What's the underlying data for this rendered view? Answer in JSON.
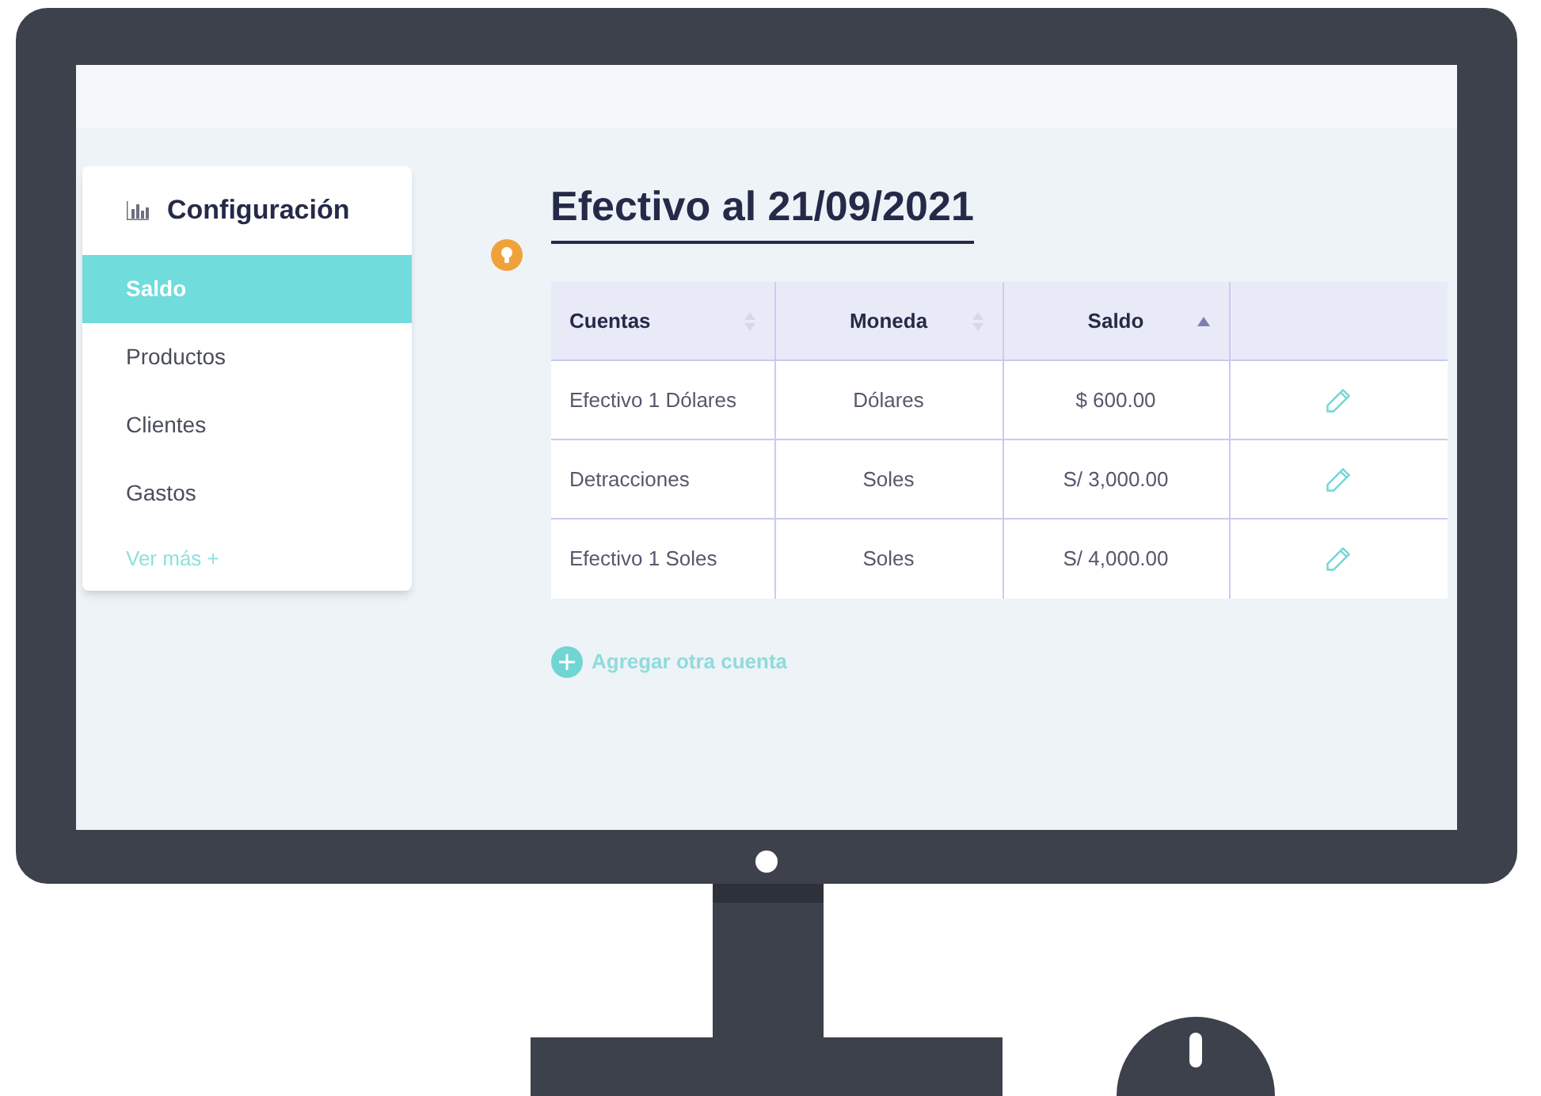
{
  "sidebar": {
    "title": "Configuración",
    "items": [
      {
        "label": "Saldo",
        "selected": true
      },
      {
        "label": "Productos",
        "selected": false
      },
      {
        "label": "Clientes",
        "selected": false
      },
      {
        "label": "Gastos",
        "selected": false
      }
    ],
    "more_link": "Ver más +"
  },
  "heading": "Efectivo al 21/09/2021",
  "table": {
    "columns": [
      {
        "label": "Cuentas",
        "sorted": false
      },
      {
        "label": "Moneda",
        "sorted": false
      },
      {
        "label": "Saldo",
        "sorted": true
      }
    ],
    "rows": [
      {
        "cells": [
          "Efectivo 1 Dólares",
          "Dólares",
          "$ 600.00"
        ]
      },
      {
        "cells": [
          "Detracciones",
          "Soles",
          "S/ 3,000.00"
        ]
      },
      {
        "cells": [
          "Efectivo 1 Soles",
          "Soles",
          "S/ 4,000.00"
        ]
      }
    ]
  },
  "add_button": "Agregar otra cuenta"
}
